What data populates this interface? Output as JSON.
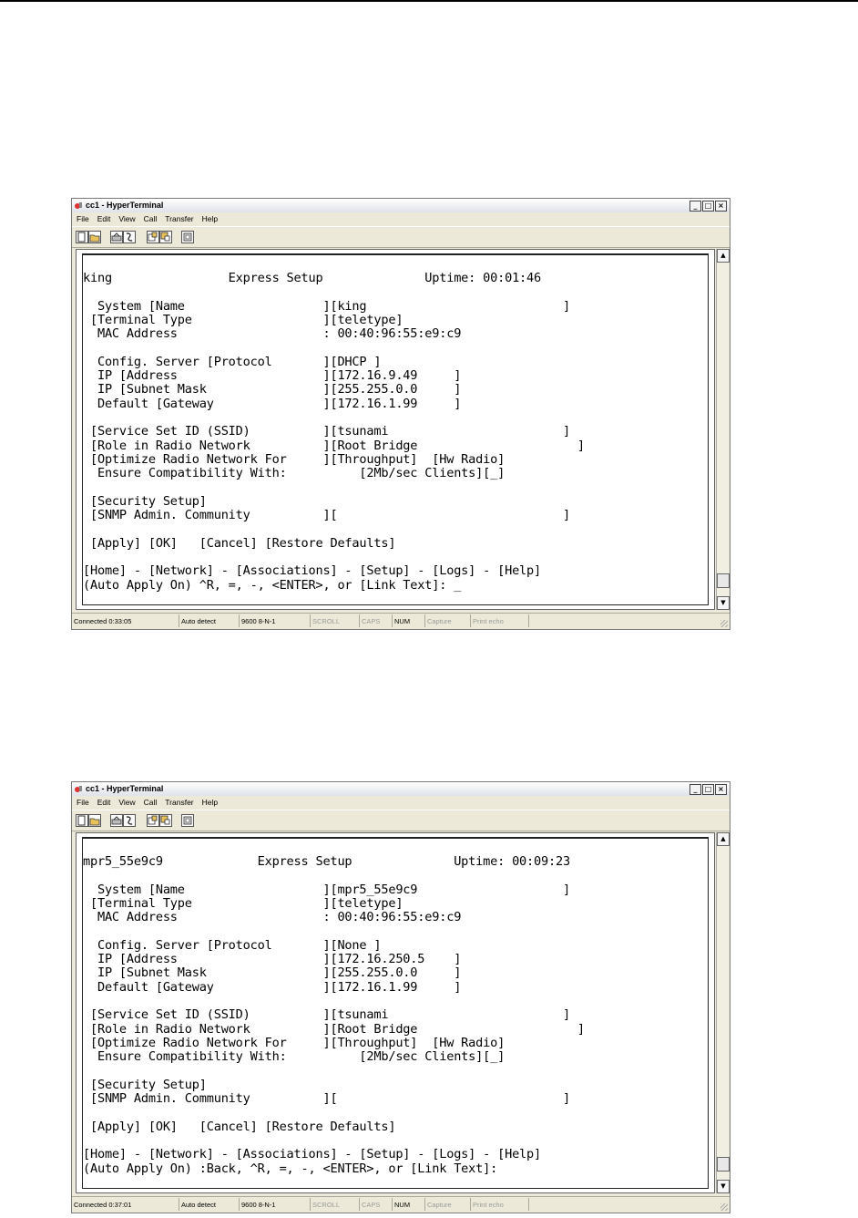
{
  "screenshots": [
    {
      "app_title": "cc1 - HyperTerminal",
      "window_controls": [
        "_",
        "□",
        "×"
      ],
      "menu": [
        "File",
        "Edit",
        "View",
        "Call",
        "Transfer",
        "Help"
      ],
      "toolbar_icons": [
        "new-connection-icon",
        "open-icon",
        "call-icon",
        "disconnect-icon",
        "send-icon",
        "receive-icon",
        "properties-icon"
      ],
      "terminal_lines": [
        "king                Express Setup              Uptime: 00:01:46",
        "",
        "  System [Name                   ][king                           ]",
        " [Terminal Type                  ][teletype]",
        "  MAC Address                    : 00:40:96:55:e9:c9",
        "",
        "  Config. Server [Protocol       ][DHCP ]",
        "  IP [Address                    ][172.16.9.49     ]",
        "  IP [Subnet Mask                ][255.255.0.0     ]",
        "  Default [Gateway               ][172.16.1.99     ]",
        "",
        " [Service Set ID (SSID)          ][tsunami                        ]",
        " [Role in Radio Network          ][Root Bridge                      ]",
        " [Optimize Radio Network For     ][Throughput]  [Hw Radio]",
        "  Ensure Compatibility With:          [2Mb/sec Clients][_]",
        "",
        " [Security Setup]",
        " [SNMP Admin. Community          ][                               ]",
        "",
        " [Apply] [OK]   [Cancel] [Restore Defaults]",
        "",
        "[Home] - [Network] - [Associations] - [Setup] - [Logs] - [Help]",
        "(Auto Apply On) ^R, =, -, <ENTER>, or [Link Text]: _"
      ],
      "status": {
        "connected": "Connected 0:33:05",
        "detect": "Auto detect",
        "port": "9600 8-N-1",
        "scroll": "SCROLL",
        "caps": "CAPS",
        "num": "NUM",
        "capture": "Capture",
        "echo": "Print echo"
      }
    },
    {
      "app_title": "cc1 - HyperTerminal",
      "window_controls": [
        "_",
        "□",
        "×"
      ],
      "menu": [
        "File",
        "Edit",
        "View",
        "Call",
        "Transfer",
        "Help"
      ],
      "toolbar_icons": [
        "new-connection-icon",
        "open-icon",
        "call-icon",
        "disconnect-icon",
        "send-icon",
        "receive-icon",
        "properties-icon"
      ],
      "terminal_lines": [
        "mpr5_55e9c9             Express Setup              Uptime: 00:09:23",
        "",
        "  System [Name                   ][mpr5_55e9c9                    ]",
        " [Terminal Type                  ][teletype]",
        "  MAC Address                    : 00:40:96:55:e9:c9",
        "",
        "  Config. Server [Protocol       ][None ]",
        "  IP [Address                    ][172.16.250.5    ]",
        "  IP [Subnet Mask                ][255.255.0.0     ]",
        "  Default [Gateway               ][172.16.1.99     ]",
        "",
        " [Service Set ID (SSID)          ][tsunami                        ]",
        " [Role in Radio Network          ][Root Bridge                      ]",
        " [Optimize Radio Network For     ][Throughput]  [Hw Radio]",
        "  Ensure Compatibility With:          [2Mb/sec Clients][_]",
        "",
        " [Security Setup]",
        " [SNMP Admin. Community          ][                               ]",
        "",
        " [Apply] [OK]   [Cancel] [Restore Defaults]",
        "",
        "[Home] - [Network] - [Associations] - [Setup] - [Logs] - [Help]",
        "(Auto Apply On) :Back, ^R, =, -, <ENTER>, or [Link Text]:"
      ],
      "status": {
        "connected": "Connected 0:37:01",
        "detect": "Auto detect",
        "port": "9600 8-N-1",
        "scroll": "SCROLL",
        "caps": "CAPS",
        "num": "NUM",
        "capture": "Capture",
        "echo": "Print echo"
      }
    }
  ]
}
